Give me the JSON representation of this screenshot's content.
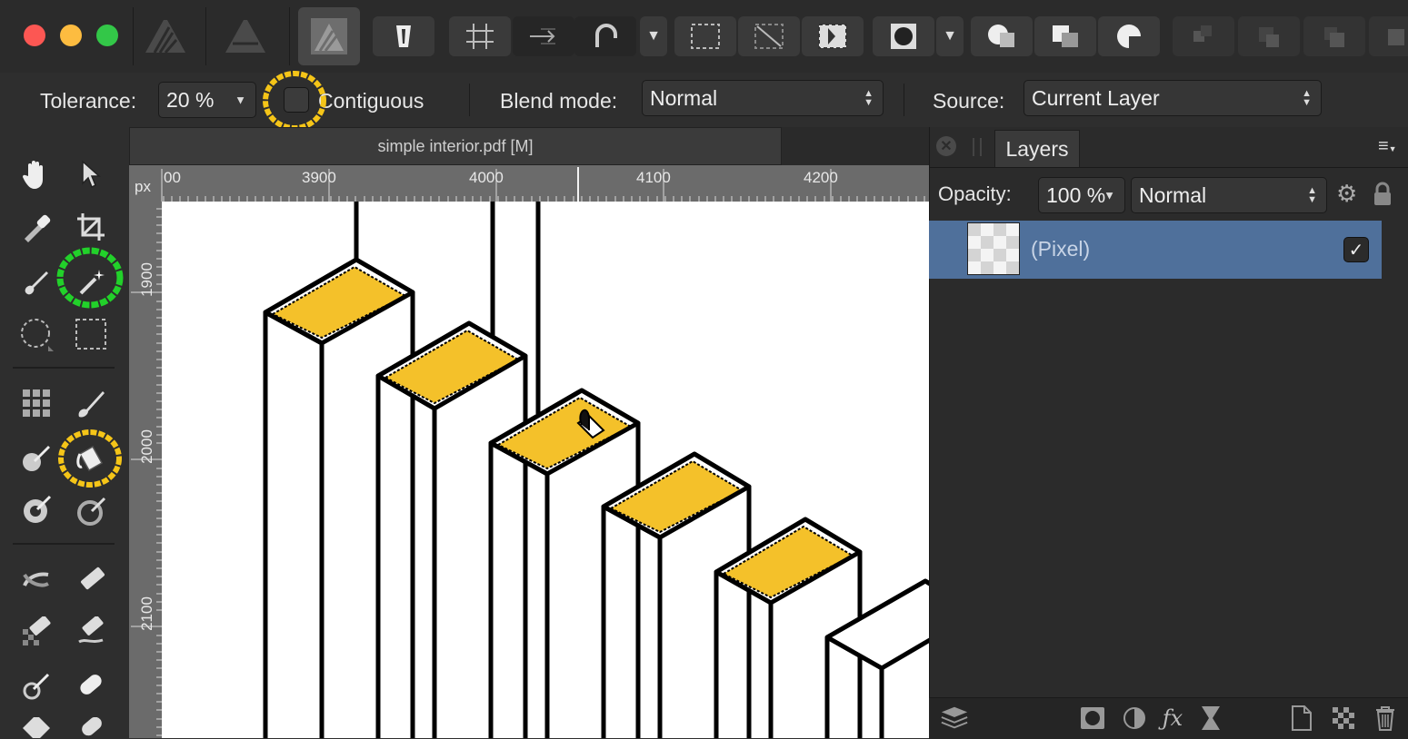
{
  "context_toolbar": {
    "tolerance_label": "Tolerance:",
    "tolerance_value": "20 %",
    "contiguous_label": "Contiguous",
    "contiguous_checked": false,
    "blend_mode_label": "Blend mode:",
    "blend_mode_value": "Normal",
    "source_label": "Source:",
    "source_value": "Current Layer"
  },
  "document": {
    "tab_title": "simple interior.pdf [M]",
    "ruler_unit": "px",
    "h_ruler_ticks": [
      "00",
      "3900",
      "4000",
      "4100",
      "4200"
    ],
    "v_ruler_ticks": [
      "1900",
      "2000",
      "2100"
    ]
  },
  "layers_panel": {
    "tab_label": "Layers",
    "opacity_label": "Opacity:",
    "opacity_value": "100 %",
    "blend_value": "Normal",
    "layers": [
      {
        "name": "(Pixel)",
        "visible": true,
        "selected": true
      }
    ]
  },
  "colors": {
    "accent_selection": "#4f709b",
    "annotation_yellow": "#f5c518",
    "annotation_green": "#22d12a",
    "fill_yellow": "#f4c12a"
  }
}
